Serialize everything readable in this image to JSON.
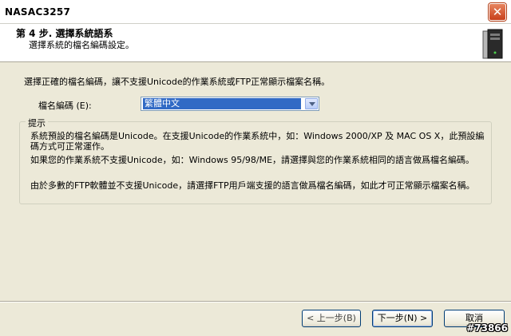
{
  "window": {
    "title": "NASAC3257",
    "close_icon": "close-icon"
  },
  "header": {
    "step_title": "第 4 步. 選擇系統語系",
    "step_subtitle": "選擇系統的檔名編碼設定。",
    "icon": "computer-tower-icon"
  },
  "main": {
    "instruction": "選擇正確的檔名編碼，讓不支援Unicode的作業系統或FTP正常顯示檔案名稱。",
    "encoding_label": "檔名編碼 (E):",
    "encoding_selected": "繁體中文"
  },
  "hint": {
    "legend": "提示",
    "paragraphs": [
      "系統預設的檔名編碼是Unicode。在支援Unicode的作業系統中，如：Windows 2000/XP 及 MAC OS X，此預設編碼方式可正常運作。",
      "如果您的作業系統不支援Unicode，如：Windows 95/98/ME，請選擇與您的作業系統相同的語言做爲檔名編碼。",
      "由於多數的FTP軟體並不支援Unicode，請選擇FTP用戶端支援的語言做爲檔名編碼，如此才可正常顯示檔案名稱。"
    ]
  },
  "footer": {
    "back_label": "< 上一步(B)",
    "next_label": "下一步(N) >",
    "cancel_label": "取消"
  },
  "watermark": "#73866",
  "colors": {
    "dialog_bg": "#ece9d8",
    "selection": "#316ac5",
    "button_border": "#003c74"
  }
}
